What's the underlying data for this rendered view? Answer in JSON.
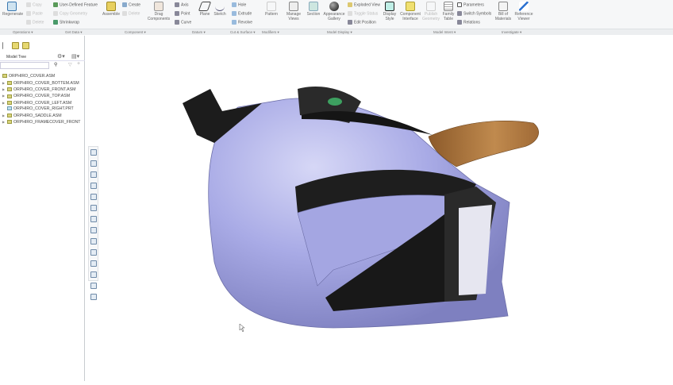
{
  "ribbon": {
    "regenerate": "Regenerate",
    "copy": "Copy",
    "paste": "Paste",
    "delete": "Delete",
    "user_defined_feature": "User-Defined Feature",
    "copy_geometry": "Copy Geometry",
    "shrinkwrap": "Shrinkwrap",
    "assemble": "Assemble",
    "create": "Create",
    "delete2": "Delete",
    "drag_components": "Drag Components",
    "axis": "Axis",
    "point": "Point",
    "curve": "Curve",
    "plane": "Plane",
    "sketch": "Sketch",
    "hole": "Hole",
    "extrude": "Extrude",
    "revolve": "Revolve",
    "pattern": "Pattern",
    "manage_views": "Manage Views",
    "section": "Section",
    "appearance_gallery": "Appearance Gallery",
    "exploded_view": "Exploded View",
    "toggle_status": "Toggle Status",
    "edit_position": "Edit Position",
    "display_style": "Display Style",
    "component_interface": "Component Interface",
    "publish_geometry": "Publish Geometry",
    "family_table": "Family Table",
    "parameters": "Parameters",
    "switch_symbols": "Switch Symbols",
    "relations": "Relations",
    "bill_of_materials": "Bill of Materials",
    "reference_viewer": "Reference Viewer"
  },
  "groups": [
    "Operations ▾",
    "Get Data ▾",
    "Component ▾",
    "Datum ▾",
    "Cut & Surface ▾",
    "Modifiers ▾",
    "Model Display ▾",
    "Model Intent ▾",
    "Investigate ▾"
  ],
  "model_tree": {
    "title": "Model Tree",
    "root": "ORPHIRO_COVER.ASM",
    "items": [
      {
        "label": "ORPHIRO_COVER_BOTTEM.ASM",
        "type": "asm"
      },
      {
        "label": "ORPHIRO_COVER_FRONT.ASM",
        "type": "asm"
      },
      {
        "label": "ORPHIRO_COVER_TOP.ASM",
        "type": "asm"
      },
      {
        "label": "ORPHIRO_COVER_LEFT.ASM",
        "type": "asm"
      },
      {
        "label": "ORPHIRO_COVER_RIGHT.PRT",
        "type": "prt"
      },
      {
        "label": "ORPHIRO_SADDLE.ASM",
        "type": "asm"
      },
      {
        "label": "ORPHIRO_FRAMECOVER_FRONT",
        "type": "asm"
      }
    ]
  },
  "colors": {
    "body": "#a9abe6",
    "saddle": "#b07a3e",
    "dark": "#1c1c1c"
  }
}
